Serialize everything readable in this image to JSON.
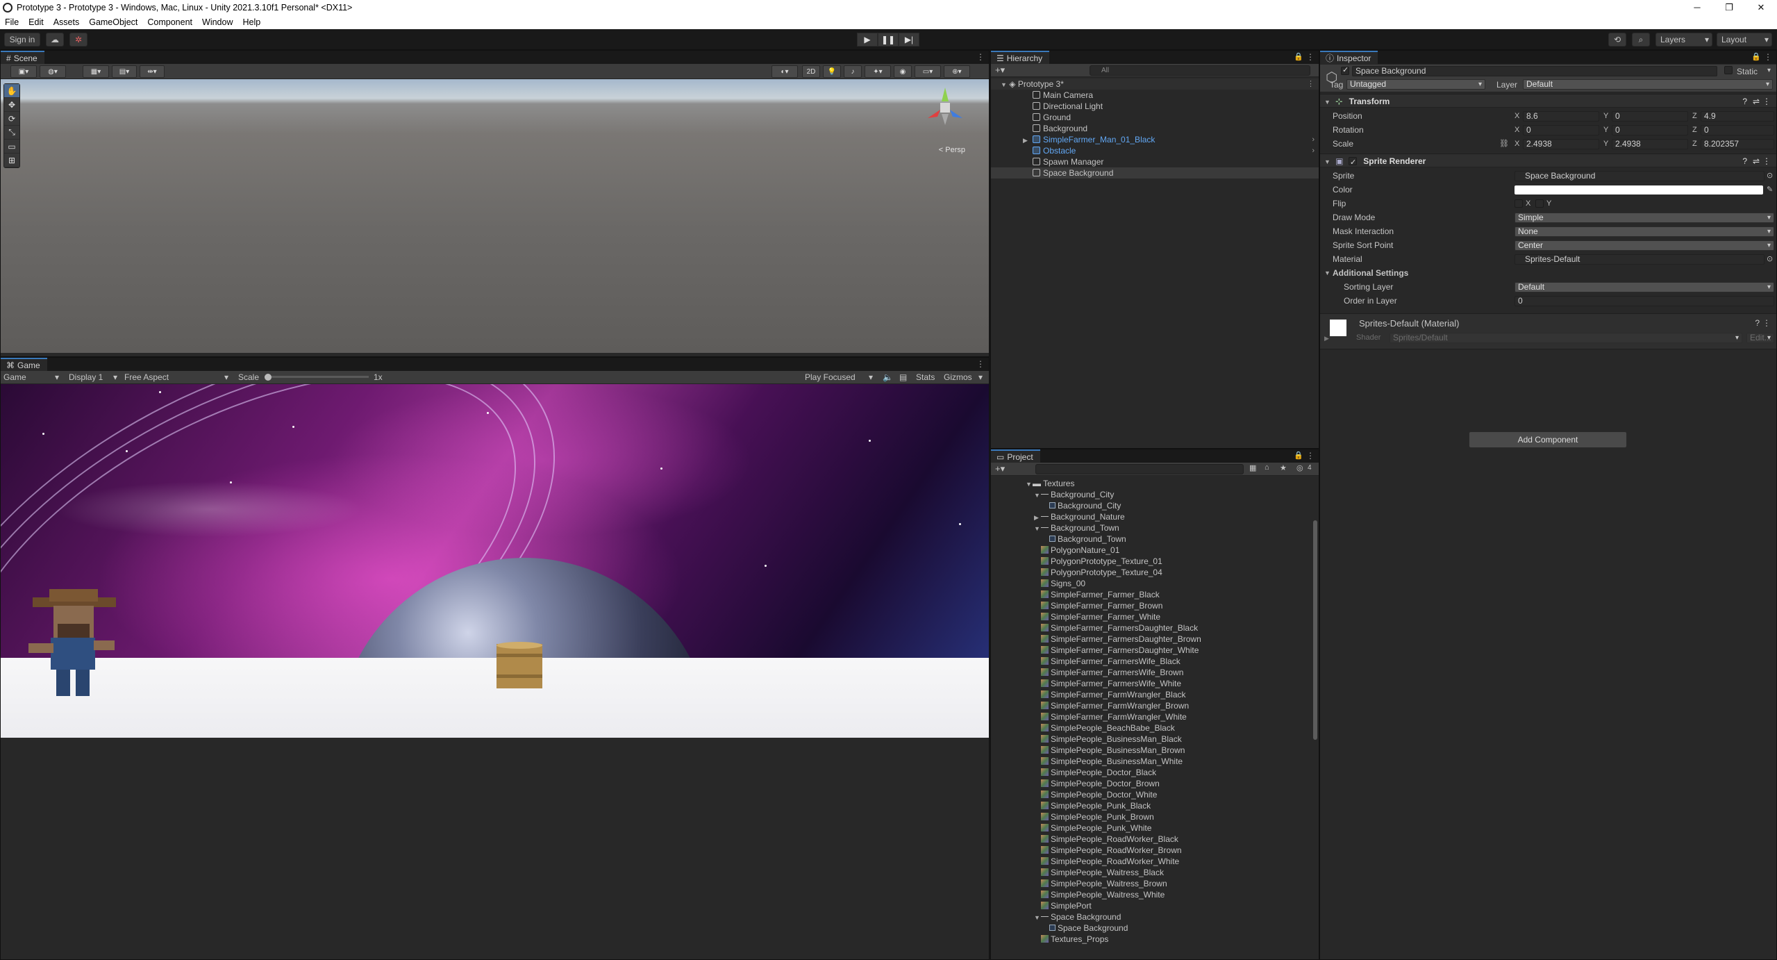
{
  "window": {
    "title": "Prototype 3 - Prototype 3 - Windows, Mac, Linux - Unity 2021.3.10f1 Personal* <DX11>",
    "minimize": "─",
    "maximize": "❐",
    "close": "✕"
  },
  "menu": [
    "File",
    "Edit",
    "Assets",
    "GameObject",
    "Component",
    "Window",
    "Help"
  ],
  "toolbar": {
    "sign_in": "Sign in",
    "layers": "Layers",
    "layout": "Layout"
  },
  "scene": {
    "tab": "Scene",
    "mode_2d": "2D",
    "persp_label": "< Persp"
  },
  "game": {
    "tab": "Game",
    "mode": "Game",
    "display": "Display 1",
    "aspect": "Free Aspect",
    "scale_label": "Scale",
    "scale_value": "1x",
    "play_focused": "Play Focused",
    "stats": "Stats",
    "gizmos": "Gizmos"
  },
  "hierarchy": {
    "tab": "Hierarchy",
    "search_placeholder": "All",
    "scene_name": "Prototype 3*",
    "items": [
      {
        "label": "Main Camera",
        "prefab": false
      },
      {
        "label": "Directional Light",
        "prefab": false
      },
      {
        "label": "Ground",
        "prefab": false
      },
      {
        "label": "Background",
        "prefab": false
      },
      {
        "label": "SimpleFarmer_Man_01_Black",
        "prefab": true
      },
      {
        "label": "Obstacle",
        "prefab": true
      },
      {
        "label": "Spawn Manager",
        "prefab": false
      },
      {
        "label": "Space Background",
        "prefab": false
      }
    ]
  },
  "project": {
    "tab": "Project",
    "hidden_count": "4",
    "items": [
      {
        "label": "Textures",
        "kind": "folder",
        "indent": 0
      },
      {
        "label": "Background_City",
        "kind": "group",
        "indent": 1
      },
      {
        "label": "Background_City",
        "kind": "sprite",
        "indent": 2
      },
      {
        "label": "Background_Nature",
        "kind": "group-collapsed",
        "indent": 1
      },
      {
        "label": "Background_Town",
        "kind": "group",
        "indent": 1
      },
      {
        "label": "Background_Town",
        "kind": "sprite",
        "indent": 2
      },
      {
        "label": "PolygonNature_01",
        "kind": "tex",
        "indent": 1
      },
      {
        "label": "PolygonPrototype_Texture_01",
        "kind": "tex",
        "indent": 1
      },
      {
        "label": "PolygonPrototype_Texture_04",
        "kind": "tex",
        "indent": 1
      },
      {
        "label": "Signs_00",
        "kind": "tex",
        "indent": 1
      },
      {
        "label": "SimpleFarmer_Farmer_Black",
        "kind": "tex",
        "indent": 1
      },
      {
        "label": "SimpleFarmer_Farmer_Brown",
        "kind": "tex",
        "indent": 1
      },
      {
        "label": "SimpleFarmer_Farmer_White",
        "kind": "tex",
        "indent": 1
      },
      {
        "label": "SimpleFarmer_FarmersDaughter_Black",
        "kind": "tex",
        "indent": 1
      },
      {
        "label": "SimpleFarmer_FarmersDaughter_Brown",
        "kind": "tex",
        "indent": 1
      },
      {
        "label": "SimpleFarmer_FarmersDaughter_White",
        "kind": "tex",
        "indent": 1
      },
      {
        "label": "SimpleFarmer_FarmersWife_Black",
        "kind": "tex",
        "indent": 1
      },
      {
        "label": "SimpleFarmer_FarmersWife_Brown",
        "kind": "tex",
        "indent": 1
      },
      {
        "label": "SimpleFarmer_FarmersWife_White",
        "kind": "tex",
        "indent": 1
      },
      {
        "label": "SimpleFarmer_FarmWrangler_Black",
        "kind": "tex",
        "indent": 1
      },
      {
        "label": "SimpleFarmer_FarmWrangler_Brown",
        "kind": "tex",
        "indent": 1
      },
      {
        "label": "SimpleFarmer_FarmWrangler_White",
        "kind": "tex",
        "indent": 1
      },
      {
        "label": "SimplePeople_BeachBabe_Black",
        "kind": "tex",
        "indent": 1
      },
      {
        "label": "SimplePeople_BusinessMan_Black",
        "kind": "tex",
        "indent": 1
      },
      {
        "label": "SimplePeople_BusinessMan_Brown",
        "kind": "tex",
        "indent": 1
      },
      {
        "label": "SimplePeople_BusinessMan_White",
        "kind": "tex",
        "indent": 1
      },
      {
        "label": "SimplePeople_Doctor_Black",
        "kind": "tex",
        "indent": 1
      },
      {
        "label": "SimplePeople_Doctor_Brown",
        "kind": "tex",
        "indent": 1
      },
      {
        "label": "SimplePeople_Doctor_White",
        "kind": "tex",
        "indent": 1
      },
      {
        "label": "SimplePeople_Punk_Black",
        "kind": "tex",
        "indent": 1
      },
      {
        "label": "SimplePeople_Punk_Brown",
        "kind": "tex",
        "indent": 1
      },
      {
        "label": "SimplePeople_Punk_White",
        "kind": "tex",
        "indent": 1
      },
      {
        "label": "SimplePeople_RoadWorker_Black",
        "kind": "tex",
        "indent": 1
      },
      {
        "label": "SimplePeople_RoadWorker_Brown",
        "kind": "tex",
        "indent": 1
      },
      {
        "label": "SimplePeople_RoadWorker_White",
        "kind": "tex",
        "indent": 1
      },
      {
        "label": "SimplePeople_Waitress_Black",
        "kind": "tex",
        "indent": 1
      },
      {
        "label": "SimplePeople_Waitress_Brown",
        "kind": "tex",
        "indent": 1
      },
      {
        "label": "SimplePeople_Waitress_White",
        "kind": "tex",
        "indent": 1
      },
      {
        "label": "SimplePort",
        "kind": "tex",
        "indent": 1
      },
      {
        "label": "Space Background",
        "kind": "group",
        "indent": 1
      },
      {
        "label": "Space Background",
        "kind": "sprite",
        "indent": 2
      },
      {
        "label": "Textures_Props",
        "kind": "tex",
        "indent": 1
      }
    ]
  },
  "inspector": {
    "tab": "Inspector",
    "object_name": "Space Background",
    "static_label": "Static",
    "tag_label": "Tag",
    "tag_value": "Untagged",
    "layer_label": "Layer",
    "layer_value": "Default",
    "transform": {
      "title": "Transform",
      "position_label": "Position",
      "rotation_label": "Rotation",
      "scale_label": "Scale",
      "position": {
        "x": "8.6",
        "y": "0",
        "z": "4.9"
      },
      "rotation": {
        "x": "0",
        "y": "0",
        "z": "0"
      },
      "scale": {
        "x": "2.4938",
        "y": "2.4938",
        "z": "8.202357"
      }
    },
    "sprite_renderer": {
      "title": "Sprite Renderer",
      "sprite_label": "Sprite",
      "sprite_value": "Space Background",
      "color_label": "Color",
      "flip_label": "Flip",
      "flip_x": "X",
      "flip_y": "Y",
      "draw_mode_label": "Draw Mode",
      "draw_mode_value": "Simple",
      "mask_label": "Mask Interaction",
      "mask_value": "None",
      "sort_point_label": "Sprite Sort Point",
      "sort_point_value": "Center",
      "material_label": "Material",
      "material_value": "Sprites-Default",
      "additional_title": "Additional Settings",
      "sorting_layer_label": "Sorting Layer",
      "sorting_layer_value": "Default",
      "order_label": "Order in Layer",
      "order_value": "0"
    },
    "material": {
      "name": "Sprites-Default (Material)",
      "shader_label": "Shader",
      "shader_value": "Sprites/Default",
      "edit_label": "Edit..."
    },
    "add_component": "Add Component"
  },
  "colors": {
    "accent": "#3a79bb",
    "prefab_blue": "#62a8f5"
  }
}
